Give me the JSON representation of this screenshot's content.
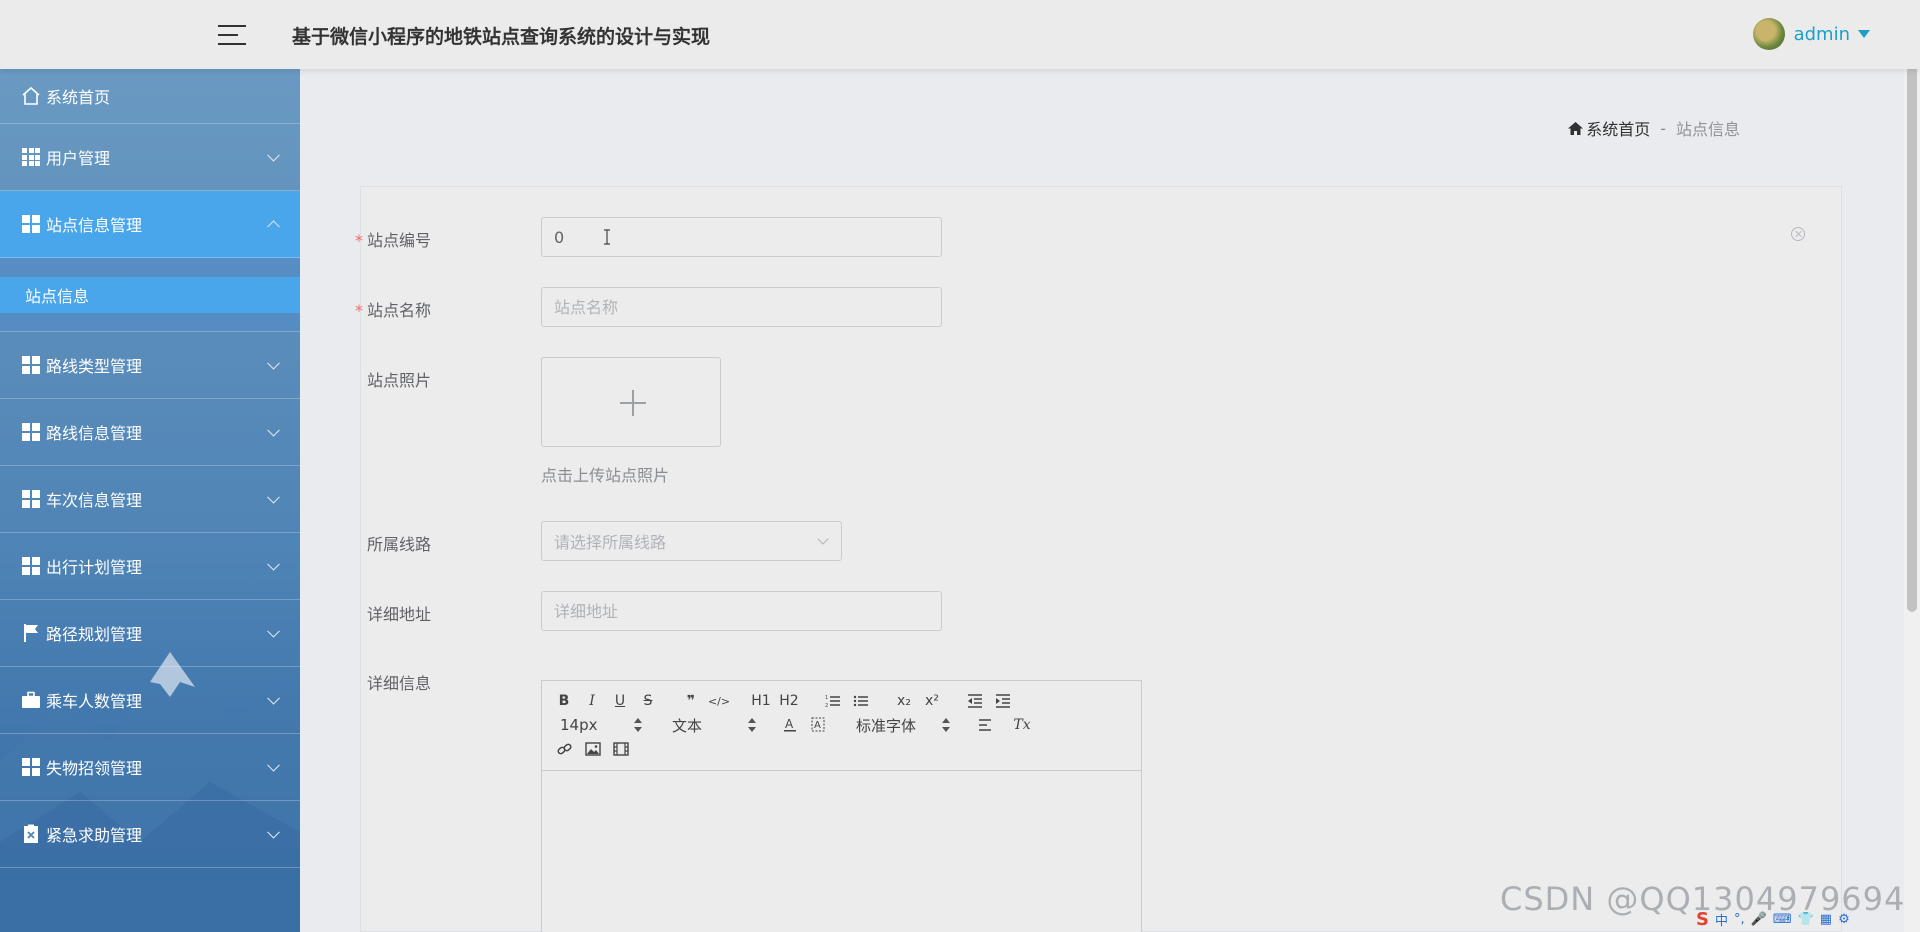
{
  "header": {
    "title": "基于微信小程序的地铁站点查询系统的设计与实现",
    "user": "admin"
  },
  "sidebar": {
    "items": [
      {
        "label": "系统首页",
        "icon": "home-icon"
      },
      {
        "label": "用户管理",
        "icon": "grid9-icon"
      },
      {
        "label": "站点信息管理",
        "icon": "grid-icon",
        "expanded": true
      },
      {
        "label": "路线类型管理",
        "icon": "grid-icon"
      },
      {
        "label": "路线信息管理",
        "icon": "grid-icon"
      },
      {
        "label": "车次信息管理",
        "icon": "grid-icon"
      },
      {
        "label": "出行计划管理",
        "icon": "grid-icon"
      },
      {
        "label": "路径规划管理",
        "icon": "flag-icon"
      },
      {
        "label": "乘车人数管理",
        "icon": "briefcase-icon"
      },
      {
        "label": "失物招领管理",
        "icon": "grid-icon"
      },
      {
        "label": "紧急求助管理",
        "icon": "clipboard-icon"
      }
    ],
    "submenu": {
      "label": "站点信息"
    }
  },
  "breadcrumb": {
    "home": "系统首页",
    "separator": "-",
    "current": "站点信息"
  },
  "form": {
    "station_no": {
      "label": "站点编号",
      "value": "0"
    },
    "station_name": {
      "label": "站点名称",
      "placeholder": "站点名称"
    },
    "station_photo": {
      "label": "站点照片",
      "hint": "点击上传站点照片"
    },
    "line": {
      "label": "所属线路",
      "placeholder": "请选择所属线路"
    },
    "address": {
      "label": "详细地址",
      "placeholder": "详细地址"
    },
    "detail": {
      "label": "详细信息"
    },
    "required_mark": "*"
  },
  "editor": {
    "toolbar": {
      "bold": "B",
      "italic": "I",
      "underline": "U",
      "strike": "S",
      "quote": "❞",
      "code": "</>",
      "h1": "H1",
      "h2": "H2",
      "sub": "x₂",
      "sup": "x²",
      "size": "14px",
      "header": "文本",
      "font": "标准字体",
      "clean": "Tx"
    }
  },
  "watermark": "CSDN @QQ1304979694",
  "colors": {
    "accent": "#4aa6ea",
    "link": "#1ba0c8",
    "required": "#f56c6c"
  }
}
